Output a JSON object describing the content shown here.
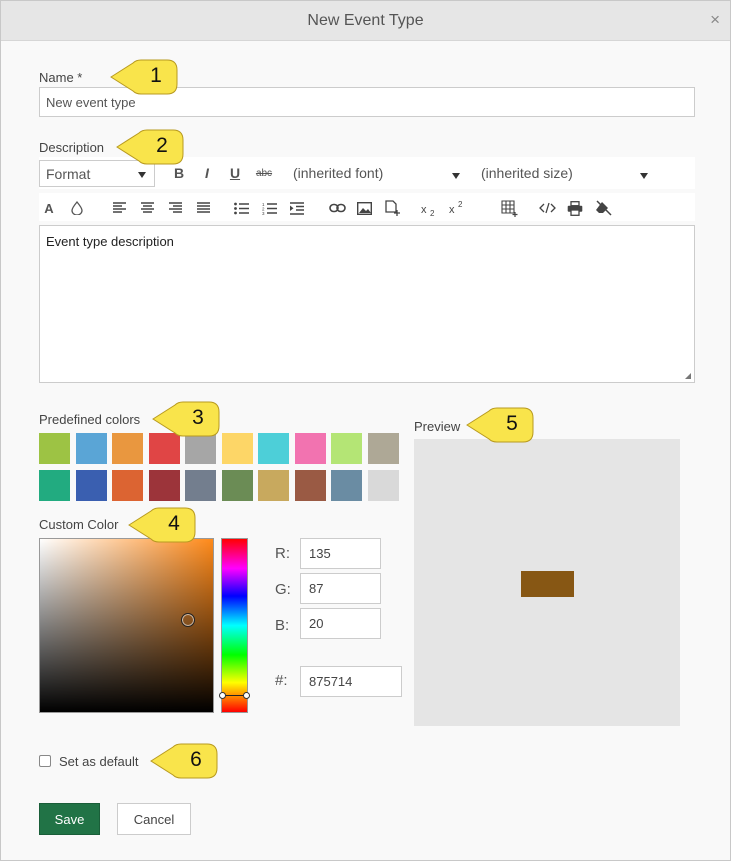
{
  "dialog": {
    "title": "New Event Type",
    "close_symbol": "×"
  },
  "name": {
    "label": "Name *",
    "value": "New event type"
  },
  "description": {
    "label": "Description",
    "format_label": "Format",
    "font_label": "(inherited font)",
    "size_label": "(inherited size)",
    "bold": "B",
    "italic": "I",
    "underline": "U",
    "strike": "abc",
    "font_color": "A",
    "content": "Event type description"
  },
  "predefined": {
    "label": "Predefined colors",
    "colors": [
      "#9dc344",
      "#5aa5d6",
      "#e9973f",
      "#e04545",
      "#a6a6a6",
      "#fdd667",
      "#4dcfd8",
      "#f273b0",
      "#b4e575",
      "#aea896",
      "#22ab80",
      "#3a5fb0",
      "#dc6432",
      "#9c343a",
      "#737e8e",
      "#6b8c55",
      "#c8a95e",
      "#9a5a44",
      "#6a8ca3",
      "#d9d9d9"
    ]
  },
  "custom": {
    "label": "Custom Color",
    "hue_color": "#ff8a1a",
    "r_label": "R:",
    "g_label": "G:",
    "b_label": "B:",
    "hex_label": "#:",
    "r": "135",
    "g": "87",
    "b": "20",
    "hex": "875714"
  },
  "preview": {
    "label": "Preview",
    "color": "#875714"
  },
  "set_default": {
    "label": "Set as default",
    "checked": false
  },
  "buttons": {
    "save": "Save",
    "cancel": "Cancel"
  },
  "callouts": [
    "1",
    "2",
    "3",
    "4",
    "5",
    "6"
  ],
  "colors": {
    "callout_fill": "#f9e44b",
    "save_bg": "#217346"
  }
}
